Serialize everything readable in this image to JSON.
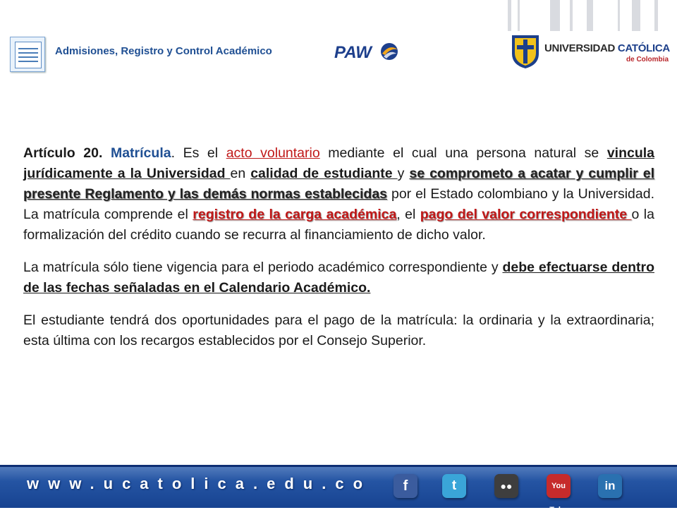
{
  "header": {
    "title": "Admisiones, Registro y Control Académico",
    "paw_logo_text": "PAW",
    "university_name_part1": "UNIVERSIDAD",
    "university_name_part2": "CATÓLICA",
    "university_sub": "de Colombia"
  },
  "article": {
    "p1": {
      "label": "Artículo 20.",
      "title": "Matrícula",
      "t1": ". Es el ",
      "h1": "acto voluntario",
      "t2": " mediante el cual una persona natural se ",
      "h2": "vincula jurídicamente a la Universidad ",
      "t3": "en ",
      "h3": "calidad de estudiante ",
      "t4": "y ",
      "h4": "se comprometo a acatar y cumplir el presente Reglamento y las demás normas establecidas",
      "t5": " por el Estado colombiano y la Universidad. La matrícula comprende el ",
      "h5": "registro de la carga académica",
      "t6": ", el ",
      "h6": "pago del valor correspondiente ",
      "t7": "o la formalización del crédito cuando se recurra al financiamiento de dicho valor."
    },
    "p2": {
      "t1": "La matrícula sólo tiene vigencia para el periodo académico correspondiente y ",
      "h1": "debe efectuarse dentro de las fechas señaladas en el Calendario Académico."
    },
    "p3": {
      "t1": "El estudiante tendrá dos oportunidades para el pago de la matrícula: la ordinaria y la extraordinaria; esta última con los recargos establecidos por el Consejo Superior."
    }
  },
  "footer": {
    "url": "www.ucatolica.edu.co",
    "social": [
      {
        "name": "facebook-icon",
        "glyph": "f"
      },
      {
        "name": "twitter-icon",
        "glyph": "t"
      },
      {
        "name": "flickr-icon",
        "glyph": "●●"
      },
      {
        "name": "youtube-icon",
        "glyph": "You Tube"
      },
      {
        "name": "linkedin-icon",
        "glyph": "in"
      }
    ]
  },
  "colors": {
    "accent_blue": "#1f4f93",
    "highlight_red": "#c01818",
    "footer_blue": "#2d5fae"
  }
}
